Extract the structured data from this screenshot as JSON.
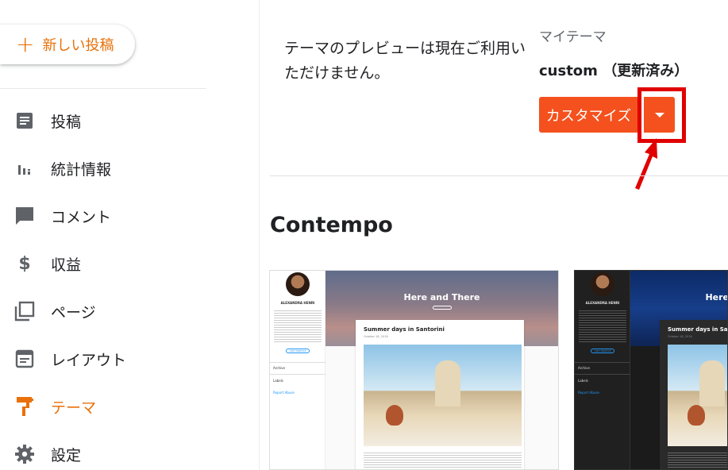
{
  "sidebar": {
    "new_post": "新しい投稿",
    "items": [
      {
        "label": "投稿",
        "icon": "posts-icon"
      },
      {
        "label": "統計情報",
        "icon": "stats-icon"
      },
      {
        "label": "コメント",
        "icon": "comment-icon"
      },
      {
        "label": "収益",
        "icon": "dollar-icon"
      },
      {
        "label": "ページ",
        "icon": "pages-icon"
      },
      {
        "label": "レイアウト",
        "icon": "layout-icon"
      },
      {
        "label": "テーマ",
        "icon": "paint-roller-icon",
        "active": true
      },
      {
        "label": "設定",
        "icon": "gear-icon"
      }
    ]
  },
  "main": {
    "preview_message": "テーマのプレビューは現在ご利用いただけません。",
    "my_theme_label": "マイテーマ",
    "theme_name": "custom （更新済み）",
    "customize_label": "カスタマイズ",
    "section_title": "Contempo"
  },
  "thumbnails": [
    {
      "author": "ALEXANDRA HENRI",
      "visit_label": "VISIT PROFILE",
      "archive_label": "Archive",
      "labels_label": "Labels",
      "report_label": "Report Abuse",
      "blog_title": "Here and There",
      "post_title": "Summer days in Santorini",
      "post_date": "October 18, 2016"
    },
    {
      "author": "ALEXANDRA HENRI",
      "visit_label": "VISIT PROFILE",
      "archive_label": "Archive",
      "labels_label": "Labels",
      "report_label": "Report Abuse",
      "blog_title": "Here",
      "post_title": "Summer days in Santori",
      "post_date": "October 18, 2016"
    }
  ],
  "colors": {
    "accent": "#e8710a",
    "button": "#f4511e",
    "highlight": "#e00000"
  }
}
